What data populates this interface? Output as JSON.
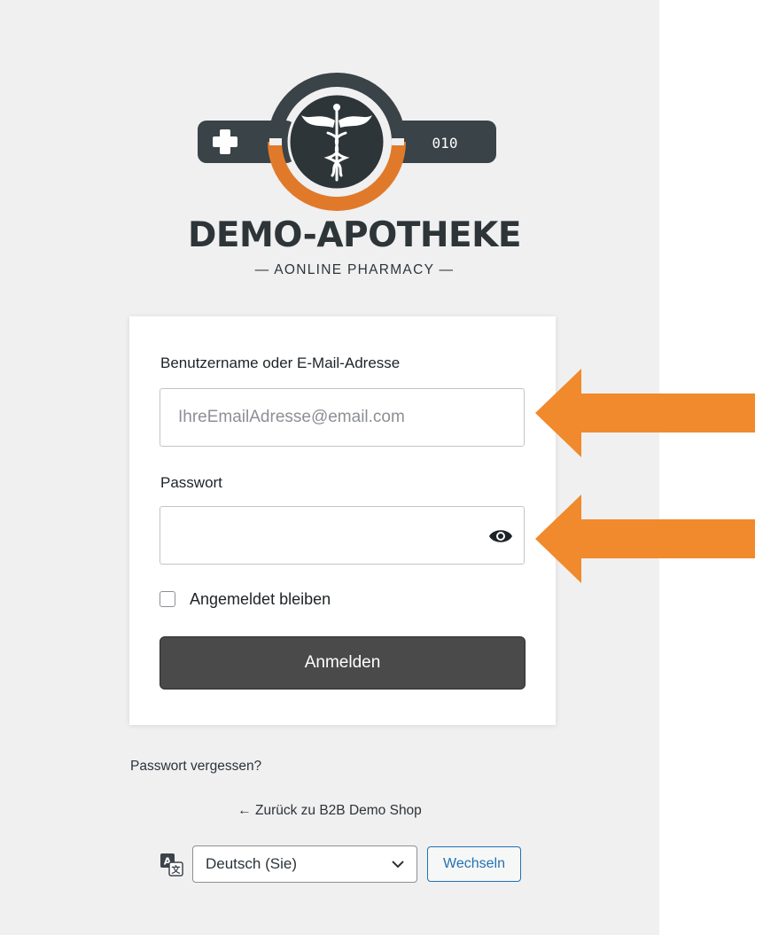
{
  "logo": {
    "title": "DEMO-APOTHEKE",
    "subtitle": "— AONLINE PHARMACY —",
    "badge_text": "010"
  },
  "login_form": {
    "username_label": "Benutzername oder E-Mail-Adresse",
    "username_placeholder": "IhreEmailAdresse@email.com",
    "username_value": "",
    "password_label": "Passwort",
    "password_value": "",
    "remember_label": "Angemeldet bleiben",
    "remember_checked": false,
    "submit_label": "Anmelden"
  },
  "links": {
    "lost_password": "Passwort vergessen?",
    "back_to_site": "← Zurück zu B2B Demo Shop"
  },
  "language": {
    "selected": "Deutsch (Sie)",
    "switch_label": "Wechseln"
  },
  "colors": {
    "background": "#f0f0f1",
    "accent_arrow": "#f08a2c",
    "logo_dark": "#2d3539",
    "logo_orange": "#e07a2a",
    "button_dark": "#4a4a4a",
    "link_blue": "#2271b1"
  },
  "icons": [
    "plus-icon",
    "caduceus-icon",
    "eye-icon",
    "translate-icon",
    "chevron-down-icon",
    "arrow-left-icon"
  ]
}
